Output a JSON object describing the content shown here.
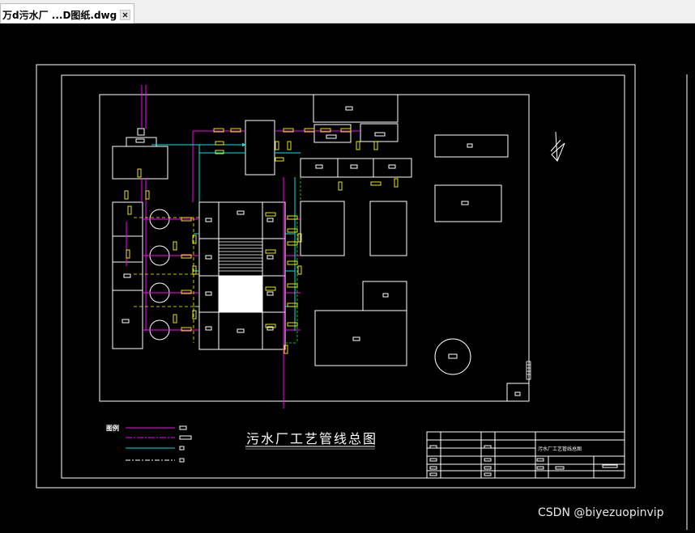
{
  "tab": {
    "title": "万d污水厂 ...D图纸.dwg"
  },
  "drawing": {
    "title": "污水厂工艺管线总图",
    "legend_heading": "图例",
    "title_block_name": "污水厂工艺管线总图"
  },
  "watermark": "CSDN @biyezuopinvip",
  "colors": {
    "background": "#000000",
    "frame": "#ffffff",
    "pipe_magenta": "#ff00ff",
    "pipe_cyan": "#00e5e5",
    "pipe_green": "#00c800",
    "label_yellow": "#ffff00"
  },
  "icons": {
    "close": "close-icon",
    "north_arrow": "north-arrow-icon"
  }
}
